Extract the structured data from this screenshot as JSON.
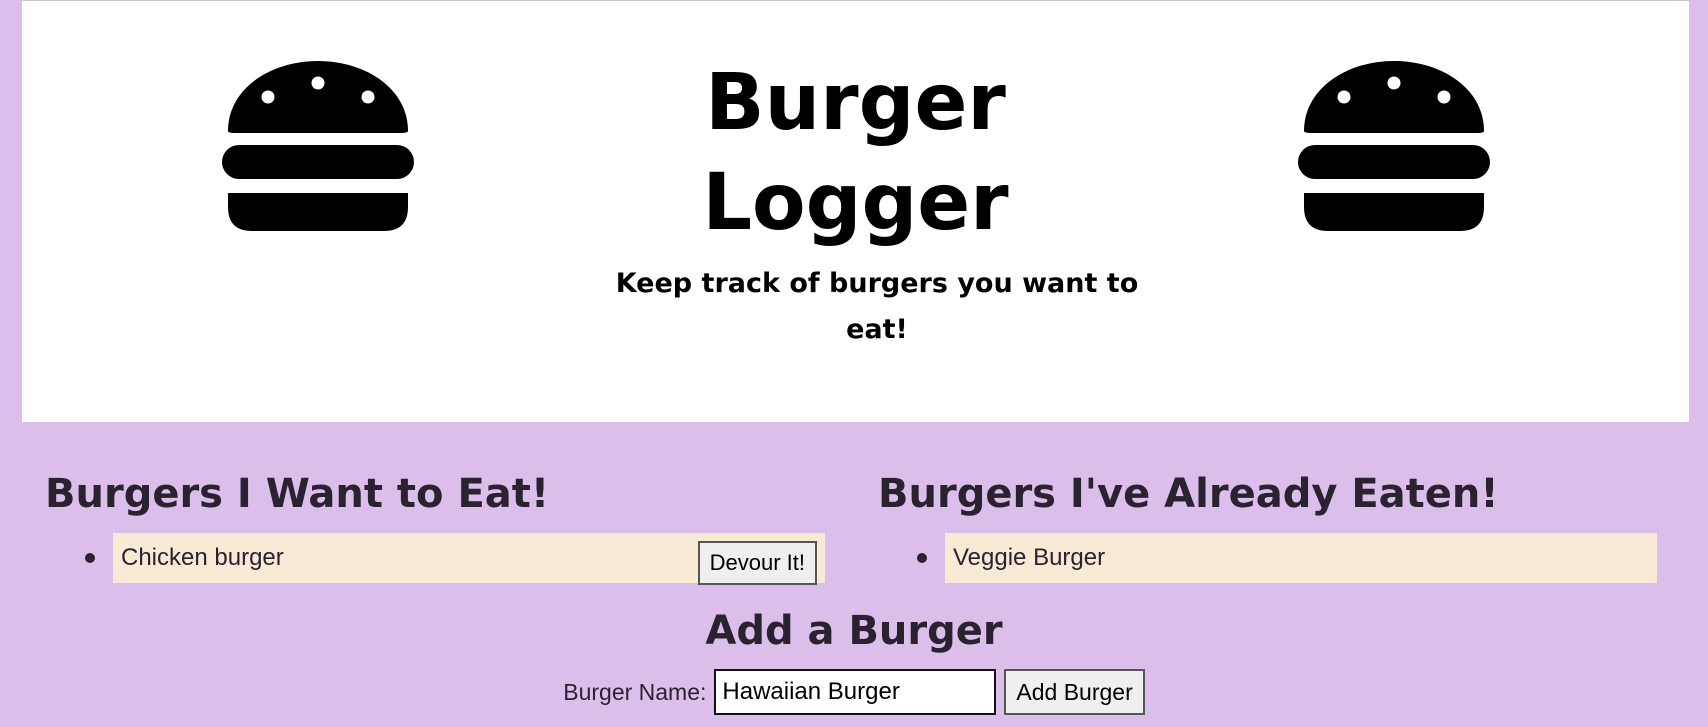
{
  "header": {
    "title_line1": "Burger",
    "title_line2": "Logger",
    "subtitle": "Keep track of burgers you want to eat!",
    "icon": "hamburger-icon"
  },
  "want_to_eat": {
    "heading": "Burgers I Want to Eat!",
    "items": [
      {
        "name": "Chicken burger",
        "button_label": "Devour It!"
      }
    ]
  },
  "already_eaten": {
    "heading": "Burgers I've Already Eaten!",
    "items": [
      {
        "name": "Veggie Burger"
      }
    ]
  },
  "add_form": {
    "heading": "Add a Burger",
    "label": "Burger Name:",
    "input_value": "Hawaiian Burger",
    "submit_label": "Add Burger"
  },
  "colors": {
    "page_background": "#dbbfea",
    "jumbotron_background": "#ffffff",
    "item_background": "#f9ead6",
    "text": "#2a2230"
  }
}
